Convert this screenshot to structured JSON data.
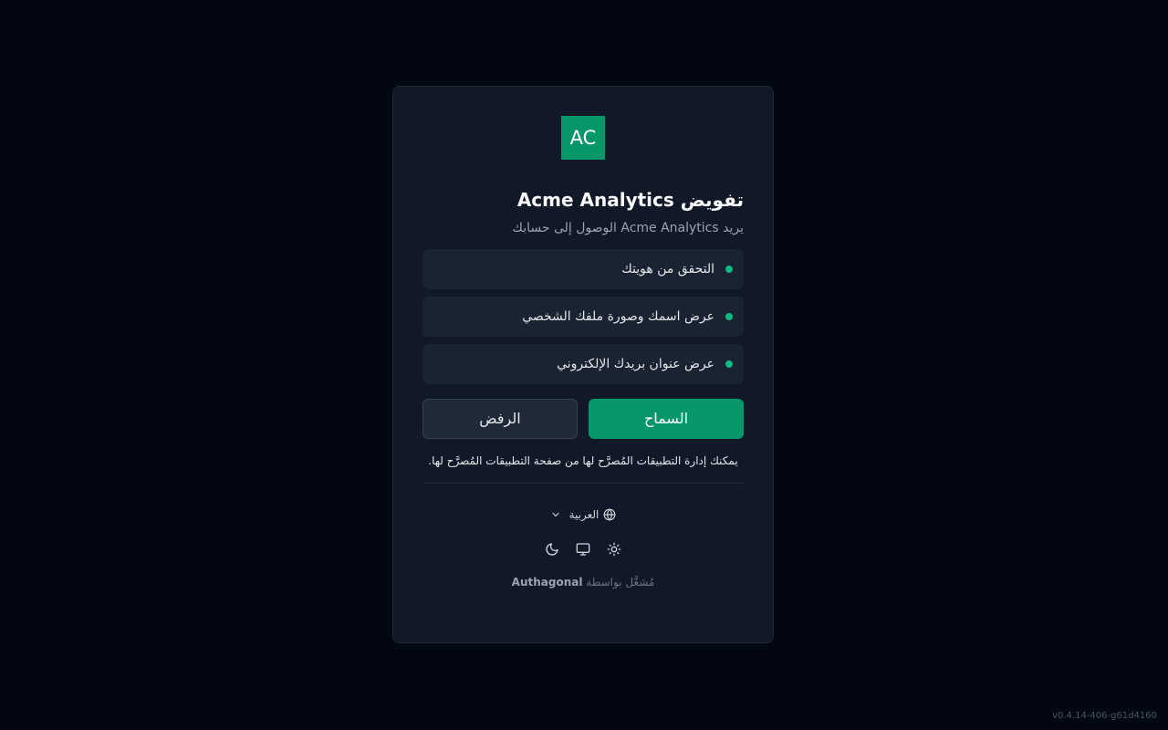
{
  "app": {
    "logo_text": "AC",
    "title": "تفويض Acme Analytics",
    "subtitle": "يريد Acme Analytics الوصول إلى حسابك"
  },
  "scopes": [
    {
      "label": "التحقق من هويتك"
    },
    {
      "label": "عرض اسمك وصورة ملفك الشخصي"
    },
    {
      "label": "عرض عنوان بريدك الإلكتروني"
    }
  ],
  "actions": {
    "allow_label": "السماح",
    "deny_label": "الرفض"
  },
  "note": "يمكنك إدارة التطبيقات المُصرَّح لها من صفحة التطبيقات المُصرَّح لها.",
  "language": {
    "selected": "العربية",
    "icon": "globe-icon"
  },
  "theme": {
    "icons": [
      "sun-icon",
      "monitor-icon",
      "moon-icon"
    ]
  },
  "footer": {
    "powered_prefix": "مُشغَّل بواسطة",
    "powered_brand": "Authagonal"
  },
  "version": "v0.4.14-406-g61d4160",
  "colors": {
    "background": "#030712",
    "card": "#111827",
    "accent": "#059669",
    "scope_dot": "#10b981"
  }
}
